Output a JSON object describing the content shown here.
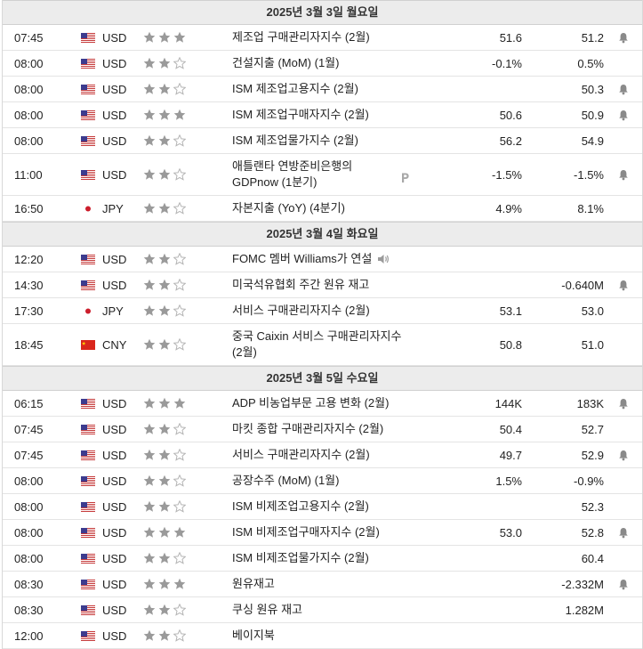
{
  "colors": {
    "star_filled": "#9a9a9a",
    "star_empty_stroke": "#b4b4b4",
    "bell": "#8a8a8a"
  },
  "days": [
    {
      "header": "2025년 3월 3일 월요일",
      "rows": [
        {
          "time": "07:45",
          "flag": "us",
          "currency": "USD",
          "importance": 3,
          "event": "제조업 구매관리자지수 (2월)",
          "previous": "51.6",
          "actual": "51.2",
          "bell": true
        },
        {
          "time": "08:00",
          "flag": "us",
          "currency": "USD",
          "importance": 2,
          "event": "건설지출 (MoM) (1월)",
          "previous": "-0.1%",
          "actual": "0.5%",
          "bell": false
        },
        {
          "time": "08:00",
          "flag": "us",
          "currency": "USD",
          "importance": 2,
          "event": "ISM 제조업고용지수 (2월)",
          "previous": "",
          "actual": "50.3",
          "bell": true
        },
        {
          "time": "08:00",
          "flag": "us",
          "currency": "USD",
          "importance": 3,
          "event": "ISM 제조업구매자지수 (2월)",
          "previous": "50.6",
          "actual": "50.9",
          "bell": true
        },
        {
          "time": "08:00",
          "flag": "us",
          "currency": "USD",
          "importance": 2,
          "event": "ISM 제조업물가지수 (2월)",
          "previous": "56.2",
          "actual": "54.9",
          "bell": false
        },
        {
          "time": "11:00",
          "flag": "us",
          "currency": "USD",
          "importance": 2,
          "event": "애틀랜타 연방준비은행의 GDPnow (1분기)",
          "previous": "-1.5%",
          "actual": "-1.5%",
          "bell": true,
          "tall": true,
          "extra_icon": "preliminary-icon"
        },
        {
          "time": "16:50",
          "flag": "jp",
          "currency": "JPY",
          "importance": 2,
          "event": "자본지출 (YoY) (4분기)",
          "previous": "4.9%",
          "actual": "8.1%",
          "bell": false
        }
      ]
    },
    {
      "header": "2025년 3월 4일 화요일",
      "rows": [
        {
          "time": "12:20",
          "flag": "us",
          "currency": "USD",
          "importance": 2,
          "event": "FOMC 멤버 Williams가 연설",
          "previous": "",
          "actual": "",
          "bell": false,
          "extra_icon": "speaker-icon"
        },
        {
          "time": "14:30",
          "flag": "us",
          "currency": "USD",
          "importance": 2,
          "event": "미국석유협회 주간 원유 재고",
          "previous": "",
          "actual": "-0.640M",
          "bell": true
        },
        {
          "time": "17:30",
          "flag": "jp",
          "currency": "JPY",
          "importance": 2,
          "event": "서비스 구매관리자지수 (2월)",
          "previous": "53.1",
          "actual": "53.0",
          "bell": false
        },
        {
          "time": "18:45",
          "flag": "cn",
          "currency": "CNY",
          "importance": 2,
          "event": "중국 Caixin 서비스 구매관리자지수 (2월)",
          "previous": "50.8",
          "actual": "51.0",
          "bell": false,
          "tall": true
        }
      ]
    },
    {
      "header": "2025년 3월 5일 수요일",
      "rows": [
        {
          "time": "06:15",
          "flag": "us",
          "currency": "USD",
          "importance": 3,
          "event": "ADP 비농업부문 고용 변화 (2월)",
          "previous": "144K",
          "actual": "183K",
          "bell": true
        },
        {
          "time": "07:45",
          "flag": "us",
          "currency": "USD",
          "importance": 2,
          "event": "마킷 종합 구매관리자지수 (2월)",
          "previous": "50.4",
          "actual": "52.7",
          "bell": false
        },
        {
          "time": "07:45",
          "flag": "us",
          "currency": "USD",
          "importance": 2,
          "event": "서비스 구매관리자지수 (2월)",
          "previous": "49.7",
          "actual": "52.9",
          "bell": true
        },
        {
          "time": "08:00",
          "flag": "us",
          "currency": "USD",
          "importance": 2,
          "event": "공장수주 (MoM) (1월)",
          "previous": "1.5%",
          "actual": "-0.9%",
          "bell": false
        },
        {
          "time": "08:00",
          "flag": "us",
          "currency": "USD",
          "importance": 2,
          "event": "ISM 비제조업고용지수 (2월)",
          "previous": "",
          "actual": "52.3",
          "bell": false
        },
        {
          "time": "08:00",
          "flag": "us",
          "currency": "USD",
          "importance": 3,
          "event": "ISM 비제조업구매자지수 (2월)",
          "previous": "53.0",
          "actual": "52.8",
          "bell": true
        },
        {
          "time": "08:00",
          "flag": "us",
          "currency": "USD",
          "importance": 2,
          "event": "ISM 비제조업물가지수 (2월)",
          "previous": "",
          "actual": "60.4",
          "bell": false
        },
        {
          "time": "08:30",
          "flag": "us",
          "currency": "USD",
          "importance": 3,
          "event": "원유재고",
          "previous": "",
          "actual": "-2.332M",
          "bell": true
        },
        {
          "time": "08:30",
          "flag": "us",
          "currency": "USD",
          "importance": 2,
          "event": "쿠싱 원유 재고",
          "previous": "",
          "actual": "1.282M",
          "bell": false
        },
        {
          "time": "12:00",
          "flag": "us",
          "currency": "USD",
          "importance": 2,
          "event": "베이지북",
          "previous": "",
          "actual": "",
          "bell": false
        }
      ]
    }
  ]
}
